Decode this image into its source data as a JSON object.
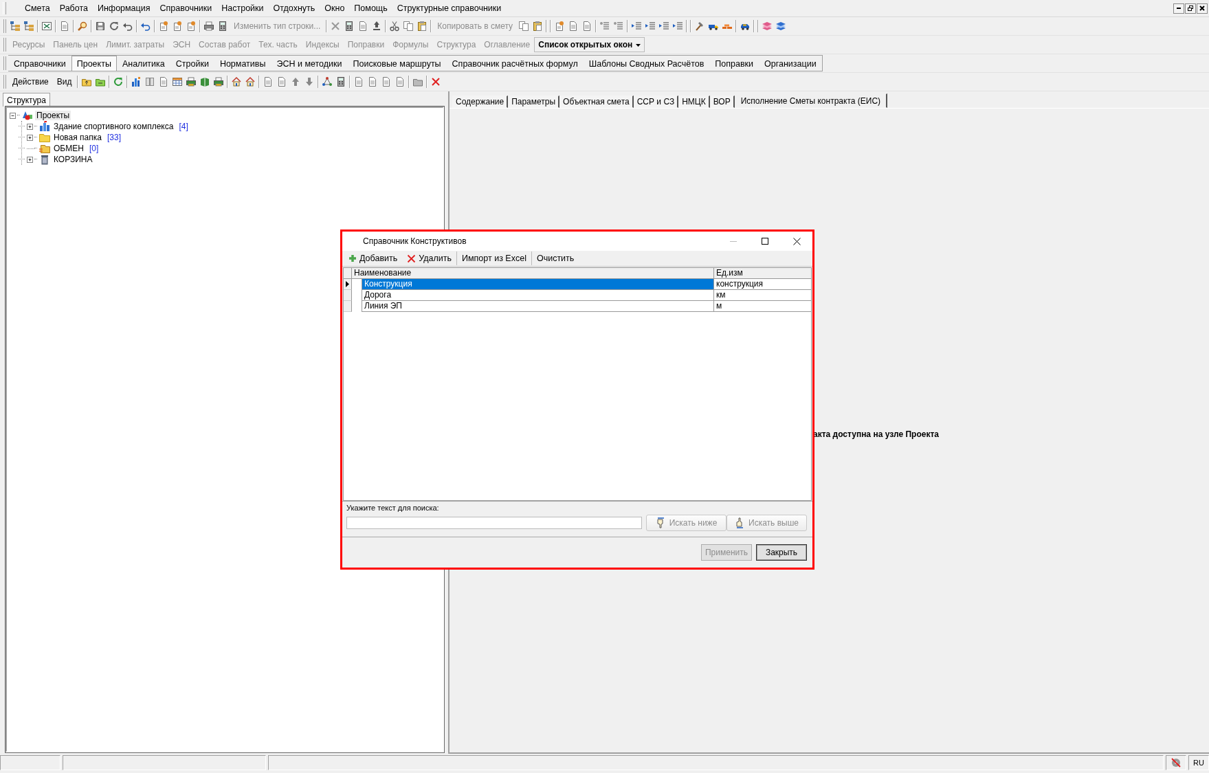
{
  "menu_bar": {
    "items": [
      "Смета",
      "Работа",
      "Информация",
      "Справочники",
      "Настройки",
      "Отдохнуть",
      "Окно",
      "Помощь",
      "Структурные справочники"
    ]
  },
  "toolbar_main": {
    "buttons": [
      {
        "label": "Изменить тип строки...",
        "disabled": true
      },
      {
        "label": "Копировать в смету",
        "disabled": true
      }
    ]
  },
  "toolbar_panels": {
    "buttons": [
      {
        "label": "Ресурсы",
        "disabled": true,
        "kind": "button"
      },
      {
        "label": "Панель цен",
        "disabled": true,
        "kind": "button"
      },
      {
        "label": "Лимит. затраты",
        "disabled": true,
        "kind": "button"
      },
      {
        "label": "ЭСН",
        "disabled": true,
        "kind": "button"
      },
      {
        "label": "Состав работ",
        "disabled": true,
        "kind": "button"
      },
      {
        "label": "Тех. часть",
        "disabled": true,
        "kind": "button"
      },
      {
        "label": "Индексы",
        "disabled": true,
        "kind": "button"
      },
      {
        "label": "Поправки",
        "disabled": true,
        "kind": "button"
      },
      {
        "label": "Формулы",
        "disabled": true,
        "kind": "button"
      },
      {
        "label": "Структура",
        "disabled": true,
        "kind": "button"
      },
      {
        "label": "Оглавление",
        "disabled": true,
        "kind": "button"
      },
      {
        "label": "Список открытых окон",
        "disabled": false,
        "kind": "dropdown"
      }
    ]
  },
  "section_tabs": [
    {
      "label": "Справочники",
      "selected": false
    },
    {
      "label": "Проекты",
      "selected": true
    },
    {
      "label": "Аналитика",
      "selected": false
    },
    {
      "label": "Стройки",
      "selected": false
    },
    {
      "label": "Нормативы",
      "selected": false
    },
    {
      "label": "ЭСН и методики",
      "selected": false
    },
    {
      "label": "Поисковые маршруты",
      "selected": false
    },
    {
      "label": "Справочник расчётных формул",
      "selected": false
    },
    {
      "label": "Шаблоны Сводных Расчётов",
      "selected": false
    },
    {
      "label": "Поправки",
      "selected": false
    },
    {
      "label": "Организации",
      "selected": false
    }
  ],
  "toolbar_actions": {
    "buttons": [
      "Действие",
      "Вид"
    ]
  },
  "left_panel": {
    "tab": "Структура",
    "tree": {
      "label": "Проекты",
      "kind": "root",
      "expanded": true,
      "children": [
        {
          "label": "Здание спортивного комплекса",
          "count": "[4]",
          "kind": "project",
          "expanded": false
        },
        {
          "label": "Новая папка",
          "count": "[33]",
          "kind": "folder",
          "expanded": false
        },
        {
          "label": "ОБМЕН",
          "count": "[0]",
          "kind": "exchange"
        },
        {
          "label": "КОРЗИНА",
          "kind": "trash",
          "expanded": false
        }
      ]
    }
  },
  "right_panel": {
    "tabs": [
      {
        "label": "Содержание",
        "selected": false
      },
      {
        "label": "Параметры",
        "selected": false
      },
      {
        "label": "Объектная смета",
        "selected": false
      },
      {
        "label": "ССР и СЗ",
        "selected": false
      },
      {
        "label": "НМЦК",
        "selected": false
      },
      {
        "label": "ВОР",
        "selected": false
      },
      {
        "label": "Исполнение Сметы контракта (ЕИС)",
        "selected": true
      }
    ],
    "message": "акта доступна на узле Проекта"
  },
  "dialog": {
    "title": "Справочник Конструктивов",
    "toolbar": [
      {
        "label": "Добавить",
        "kind": "add"
      },
      {
        "label": "Удалить",
        "kind": "delete"
      },
      {
        "label": "Импорт из Excel",
        "kind": "text"
      },
      {
        "label": "Очистить",
        "kind": "text"
      }
    ],
    "columns": [
      "Наименование",
      "Ед.изм"
    ],
    "rows": [
      {
        "name": "Конструкция",
        "unit": "конструкция",
        "selected": true
      },
      {
        "name": "Дорога",
        "unit": "км",
        "selected": false
      },
      {
        "name": "Линия ЭП",
        "unit": "м",
        "selected": false
      }
    ],
    "search": {
      "label": "Укажите текст для поиска:",
      "buttons": [
        {
          "label": "Искать ниже",
          "kind": "down",
          "disabled": true
        },
        {
          "label": "Искать выше",
          "kind": "up",
          "disabled": true
        }
      ]
    },
    "buttons": [
      {
        "label": "Применить",
        "disabled": true
      },
      {
        "label": "Закрыть",
        "disabled": false
      }
    ]
  },
  "status_bar": {
    "language": "RU"
  }
}
